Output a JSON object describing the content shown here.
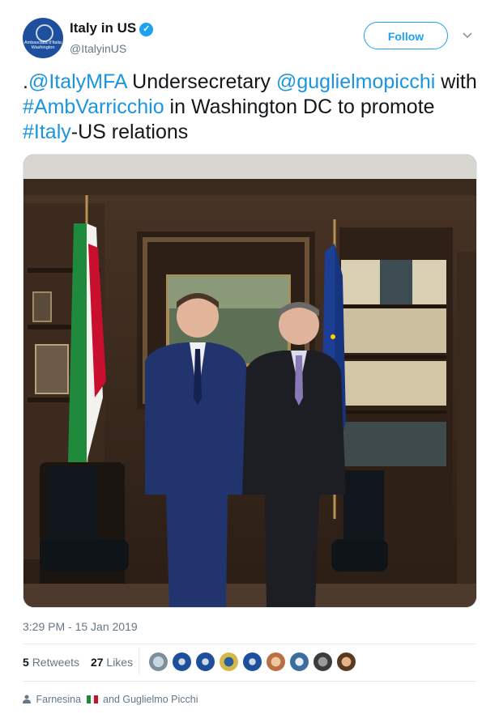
{
  "account": {
    "name": "Italy in US",
    "handle": "@ItalyinUS",
    "avatar_text": "Ambasciata d'Italia Washington",
    "verified_icon": "verified-badge-icon"
  },
  "follow_label": "Follow",
  "tweet": {
    "parts": [
      {
        "text": ".",
        "link": false
      },
      {
        "text": "@ItalyMFA",
        "link": true
      },
      {
        "text": " Undersecretary ",
        "link": false
      },
      {
        "text": "@guglielmopicchi",
        "link": true
      },
      {
        "text": " with ",
        "link": false
      },
      {
        "text": "#AmbVarricchio",
        "link": true
      },
      {
        "text": " in Washington DC to promote ",
        "link": false
      },
      {
        "text": "#Italy",
        "link": true
      },
      {
        "text": "-US relations",
        "link": false
      }
    ]
  },
  "timestamp": "3:29 PM - 15 Jan 2019",
  "stats": {
    "retweets_count": "5",
    "retweets_label": "Retweets",
    "likes_count": "27",
    "likes_label": "Likes"
  },
  "footer": {
    "person_icon": "person-icon",
    "first": "Farnesina",
    "rest": "and Guglielmo Picchi"
  },
  "colors": {
    "link": "#1b95e0",
    "accent": "#1da1f2",
    "muted": "#657786"
  }
}
